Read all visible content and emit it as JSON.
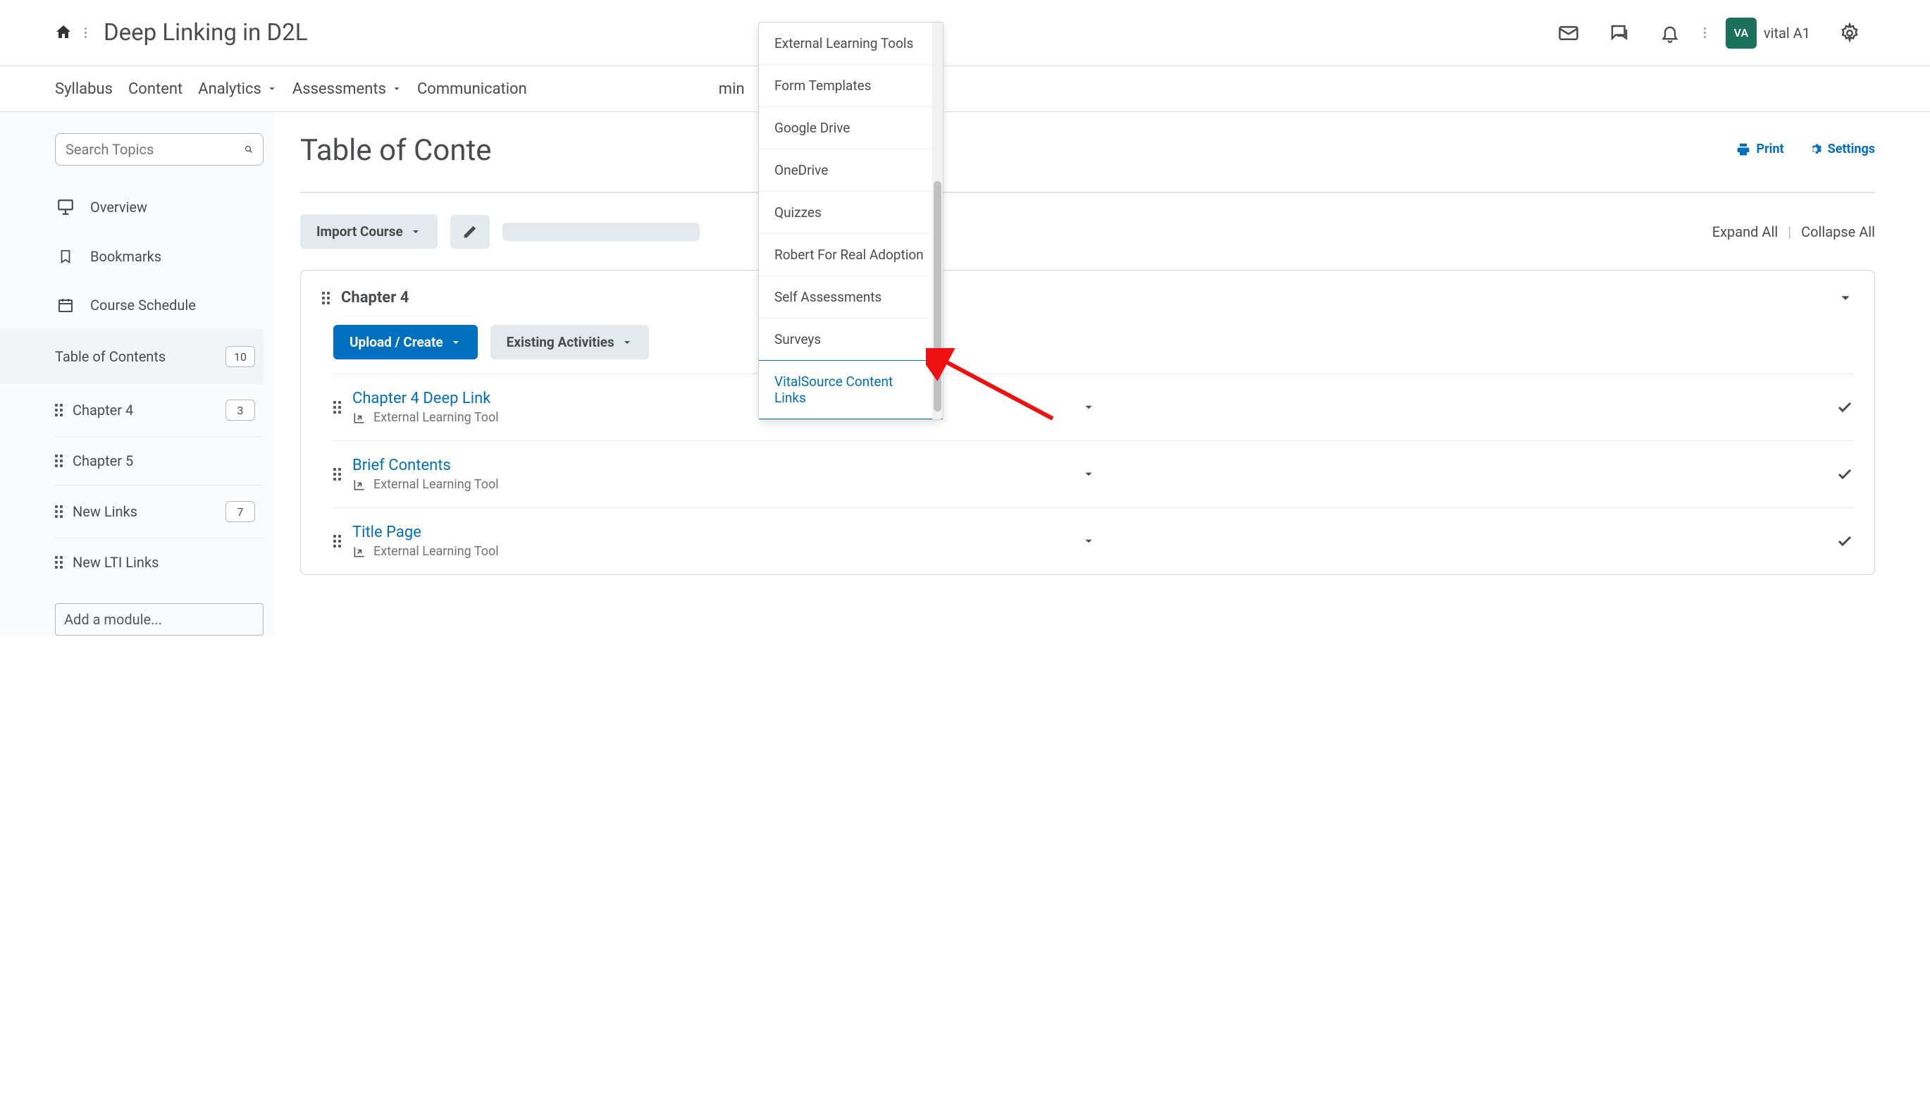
{
  "header": {
    "course_title": "Deep Linking in D2L",
    "avatar_initials": "VA",
    "username": "vital A1"
  },
  "nav": {
    "items": [
      "Syllabus",
      "Content",
      "Analytics",
      "Assessments",
      "Communication",
      "min"
    ],
    "has_chevron": [
      false,
      false,
      true,
      true,
      false,
      false
    ]
  },
  "sidebar": {
    "search_placeholder": "Search Topics",
    "overview": "Overview",
    "bookmarks": "Bookmarks",
    "schedule": "Course Schedule",
    "toc_label": "Table of Contents",
    "toc_count": "10",
    "modules": [
      {
        "name": "Chapter 4",
        "count": "3"
      },
      {
        "name": "Chapter 5",
        "count": ""
      },
      {
        "name": "New Links",
        "count": "7"
      },
      {
        "name": "New LTI Links",
        "count": ""
      }
    ],
    "add_module_placeholder": "Add a module..."
  },
  "main": {
    "page_title": "Table of Conte",
    "print": "Print",
    "settings": "Settings",
    "import_course": "Import Course",
    "expand_all": "Expand All",
    "collapse_all": "Collapse All",
    "module_title": "Chapter 4",
    "upload_create": "Upload / Create",
    "existing_activities": "Existing Activities",
    "topics": [
      {
        "title": "Chapter 4 Deep Link",
        "type": "External Learning Tool"
      },
      {
        "title": "Brief Contents",
        "type": "External Learning Tool"
      },
      {
        "title": "Title Page",
        "type": "External Learning Tool"
      }
    ]
  },
  "dropdown": {
    "items": [
      "External Learning Tools",
      "Form Templates",
      "Google Drive",
      "OneDrive",
      "Quizzes",
      "Robert For Real Adoption",
      "Self Assessments",
      "Surveys",
      "VitalSource Content Links"
    ],
    "highlighted_index": 8
  }
}
